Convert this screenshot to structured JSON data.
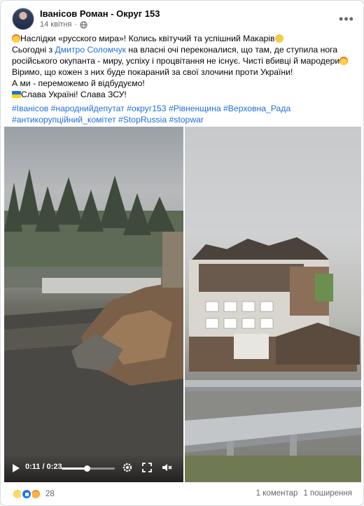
{
  "post": {
    "author": "Іванісов Роман - Округ 153",
    "date": "14 квітня",
    "globe_icon": "globe-icon",
    "more_icon": "more-options-icon",
    "lines": {
      "l1": "Наслідки «русского мира»! Колись квітучий та успішний Макарів",
      "l2_a": "Сьогодні з ",
      "l2_mention": "Дмитро Соломчук",
      "l2_b": " на власні очі переконалися, що там, де ступила нога",
      "l3": "російського окупанта - миру, успіху і процвітання не існує. Чисті вбивці й мародери",
      "l4": "Віримо, що кожен з них буде покараний за свої злочини проти України!",
      "l5": "А ми - переможемо й відбудуємо!",
      "l6": "Слава Україні! Слава ЗСУ!"
    },
    "hashtags_line1": [
      "#Іванісов",
      "#народнийдепутат",
      "#округ153",
      "#Рівненщина",
      "#Верховна_Рада"
    ],
    "hashtags_line2": [
      "#антикорупційний_комітет",
      "#StopRussia",
      "#stopwar"
    ]
  },
  "video": {
    "time": "0:11 / 0:23",
    "progress": 0.48,
    "play_icon": "play-icon",
    "settings_icon": "settings-gear-icon",
    "fullscreen_icon": "fullscreen-icon",
    "volume_icon": "volume-muted-icon"
  },
  "footer": {
    "reaction_count": "28",
    "comments": "1 коментар",
    "shares": "1 поширення"
  },
  "colors": {
    "link": "#216fdb",
    "secondary_text": "#65676b",
    "like_blue": "#1877f2"
  }
}
